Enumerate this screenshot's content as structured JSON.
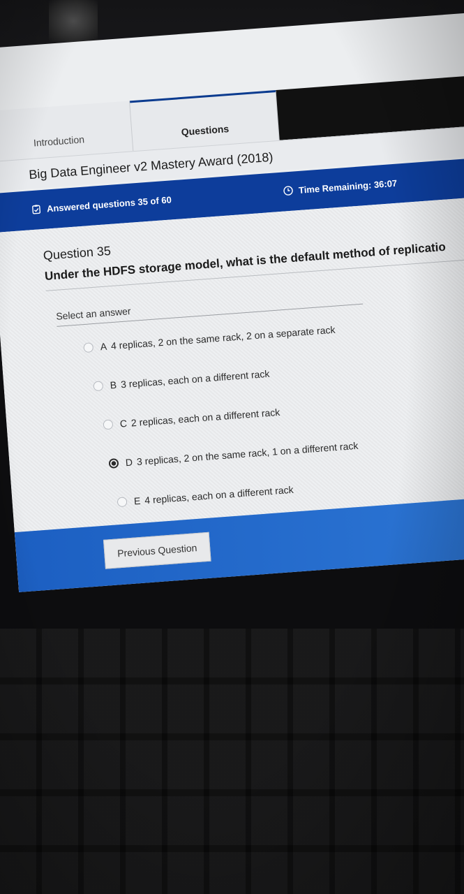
{
  "tabs": [
    {
      "label": "Introduction",
      "active": false
    },
    {
      "label": "Questions",
      "active": true
    }
  ],
  "exam_title": "Big Data Engineer v2 Mastery Award (2018)",
  "status": {
    "answered": "Answered questions 35 of 60",
    "time_remaining": "Time Remaining: 36:07"
  },
  "question": {
    "number_label": "Question 35",
    "text": "Under the HDFS storage model, what is the default method of replicatio",
    "select_prompt": "Select an answer",
    "selected_index": 3,
    "options": [
      {
        "letter": "A",
        "text": "4 replicas, 2 on the same rack, 2 on a separate rack"
      },
      {
        "letter": "B",
        "text": "3 replicas, each on a different rack"
      },
      {
        "letter": "C",
        "text": "2 replicas, each on a different rack"
      },
      {
        "letter": "D",
        "text": "3 replicas, 2 on the same rack, 1 on a different rack"
      },
      {
        "letter": "E",
        "text": "4 replicas, each on a different rack"
      }
    ]
  },
  "navigation": {
    "previous_label": "Previous Question"
  },
  "colors": {
    "status_bar": "#0d3d9b",
    "nav_bar": "#2e78d6",
    "screen_bg": "#eceef0"
  },
  "icons": {
    "answered": "clipboard-check-icon",
    "timer": "clock-icon"
  }
}
